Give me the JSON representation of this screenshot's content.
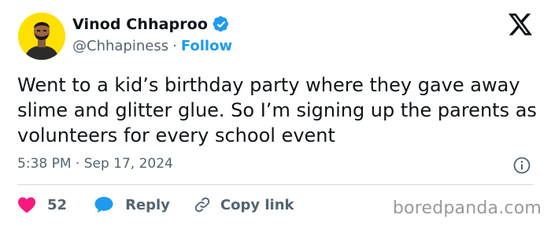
{
  "author": {
    "name": "Vinod Chhaproo",
    "handle": "@Chhapiness",
    "separator": "·",
    "follow_label": "Follow",
    "verified": true,
    "avatar_bg": "#ffe000"
  },
  "tweet": {
    "text": "Went to a kid’s birthday party where they gave away slime and glitter glue. So I’m signing up the parents as volunteers for every school event",
    "timestamp": "5:38 PM · Sep 17, 2024"
  },
  "actions": {
    "like_count": "52",
    "reply_label": "Reply",
    "copy_link_label": "Copy link"
  },
  "icons": {
    "platform_logo": "x-logo-icon",
    "verified": "verified-badge-icon",
    "info": "info-icon",
    "like": "heart-icon",
    "reply": "speech-bubble-icon",
    "copy": "link-icon"
  },
  "colors": {
    "accent": "#1d9bf0",
    "heart": "#f91880",
    "text": "#0f1419",
    "muted": "#536471"
  },
  "watermark": "boredpanda.com"
}
